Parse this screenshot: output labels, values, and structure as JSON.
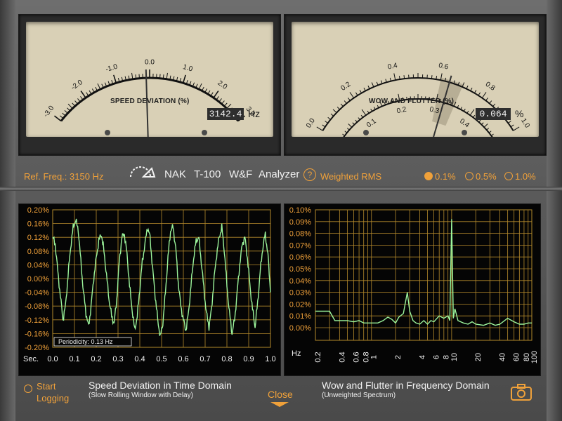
{
  "colors": {
    "accent": "#f0a13a",
    "trace": "#9cf59c",
    "meter_face": "#d9d0b6",
    "grid": "#b58a2c"
  },
  "speed_meter": {
    "ticks": [
      "-3.0",
      "-2.0",
      "-1.0",
      "0.0",
      "1.0",
      "2.0",
      "3.0"
    ],
    "title": "SPEED DEVIATION (%)",
    "readout": "3142.4",
    "unit": "Hz",
    "needle_value": -0.1
  },
  "wf_meter": {
    "outer_ticks": [
      "0.0",
      "0.2",
      "0.4",
      "0.6",
      "0.8",
      "1.0"
    ],
    "inner_ticks": [
      "0.0",
      "0.1",
      "0.2",
      "0.3",
      "0.4",
      "0.5"
    ],
    "title": "WOW AND FLUTTER (%)",
    "readout": "0.064",
    "unit": "%",
    "needle_value": 0.064,
    "peak_range": [
      0.6,
      0.7
    ]
  },
  "info": {
    "ref_freq": "Ref. Freq.: 3150 Hz",
    "brand": [
      "NAK",
      "T-100",
      "W&F",
      "Analyzer"
    ],
    "help": "?",
    "weighted": "Weighted RMS",
    "ranges": [
      {
        "label": "0.1%",
        "selected": true
      },
      {
        "label": "0.5%",
        "selected": false
      },
      {
        "label": "1.0%",
        "selected": false
      }
    ]
  },
  "time_chart": {
    "ylabels": [
      "0.20%",
      "0.16%",
      "0.12%",
      "0.08%",
      "0.04%",
      "0.00%",
      "-0.04%",
      "-0.08%",
      "-0.12%",
      "-0.16%",
      "-0.20%"
    ],
    "xunit": "Sec.",
    "xlabels": [
      "0.0",
      "0.1",
      "0.2",
      "0.3",
      "0.4",
      "0.5",
      "0.6",
      "0.7",
      "0.8",
      "0.9",
      "1.0"
    ],
    "periodicity": "Periodicity:  0.13 Hz",
    "title": "Speed Deviation in Time Domain",
    "subtitle": "(Slow Rolling Window with Delay)"
  },
  "freq_chart": {
    "ylabels": [
      "0.10%",
      "0.09%",
      "0.08%",
      "0.07%",
      "0.06%",
      "0.05%",
      "0.04%",
      "0.03%",
      "0.02%",
      "0.01%",
      "0.00%"
    ],
    "xunit": "Hz",
    "xlabels": [
      "0.2",
      "0.4",
      "0.6",
      "0.8",
      "1",
      "2",
      "4",
      "6",
      "8",
      "10",
      "20",
      "40",
      "60",
      "80",
      "100"
    ],
    "title": "Wow and Flutter in Frequency Domain",
    "subtitle": "(Unweighted Spectrum)"
  },
  "footer": {
    "start_logging": "Start\nLogging",
    "close": "Close"
  },
  "chart_data": [
    {
      "type": "line",
      "title": "Speed Deviation in Time Domain",
      "xlabel": "Sec.",
      "ylabel": "%",
      "xlim": [
        0,
        1
      ],
      "ylim": [
        -0.2,
        0.2
      ],
      "series": [
        {
          "values": [
            0.12,
            0.1,
            0.02,
            -0.05,
            -0.12,
            -0.08,
            0.01,
            0.09,
            0.15,
            0.17,
            0.14,
            0.05,
            -0.04,
            -0.1,
            -0.14,
            -0.08,
            0.0,
            0.06,
            0.11,
            0.13,
            0.08,
            0.01,
            -0.06,
            -0.11,
            -0.13,
            -0.06,
            0.05,
            0.12,
            0.13,
            0.07,
            -0.02,
            -0.09,
            -0.15,
            -0.11,
            -0.03,
            0.05,
            0.1,
            0.15,
            0.12,
            0.03,
            -0.05,
            -0.12,
            -0.17,
            -0.13,
            -0.04,
            0.06,
            0.14,
            0.15,
            0.09,
            -0.01,
            -0.08,
            -0.12,
            -0.15,
            -0.1,
            -0.02,
            0.06,
            0.11,
            0.12,
            0.05,
            -0.03,
            -0.1,
            -0.14,
            -0.09,
            0.0,
            0.07,
            0.12,
            0.15,
            0.08,
            -0.02,
            -0.1,
            -0.16,
            -0.12,
            -0.04,
            0.04,
            0.1,
            0.12,
            0.06,
            -0.02,
            -0.09,
            -0.14,
            -0.07,
            0.02,
            0.09,
            0.13,
            0.07,
            -0.04
          ]
        }
      ]
    },
    {
      "type": "line",
      "title": "Wow and Flutter in Frequency Domain",
      "xlabel": "Hz",
      "ylabel": "%",
      "xlim": [
        0.2,
        100
      ],
      "ylim": [
        0,
        0.1
      ],
      "series": [
        {
          "x": [
            0.2,
            0.25,
            0.3,
            0.35,
            0.4,
            0.5,
            0.6,
            0.7,
            0.8,
            0.9,
            1.0,
            1.2,
            1.4,
            1.6,
            1.8,
            2.0,
            2.2,
            2.5,
            2.8,
            3.0,
            3.3,
            3.6,
            4,
            4.5,
            5,
            5.5,
            6,
            7,
            8,
            9,
            9.5,
            10,
            10.5,
            11,
            12,
            14,
            16,
            18,
            20,
            25,
            30,
            35,
            40,
            50,
            60,
            70,
            80,
            90,
            100
          ],
          "y": [
            0.014,
            0.014,
            0.014,
            0.006,
            0.006,
            0.006,
            0.005,
            0.006,
            0.004,
            0.004,
            0.004,
            0.004,
            0.006,
            0.009,
            0.007,
            0.004,
            0.009,
            0.012,
            0.03,
            0.014,
            0.006,
            0.004,
            0.003,
            0.006,
            0.003,
            0.006,
            0.005,
            0.01,
            0.008,
            0.01,
            0.006,
            0.092,
            0.008,
            0.016,
            0.006,
            0.004,
            0.003,
            0.005,
            0.003,
            0.002,
            0.004,
            0.002,
            0.003,
            0.008,
            0.005,
            0.003,
            0.003,
            0.004,
            0.004
          ]
        }
      ]
    }
  ]
}
